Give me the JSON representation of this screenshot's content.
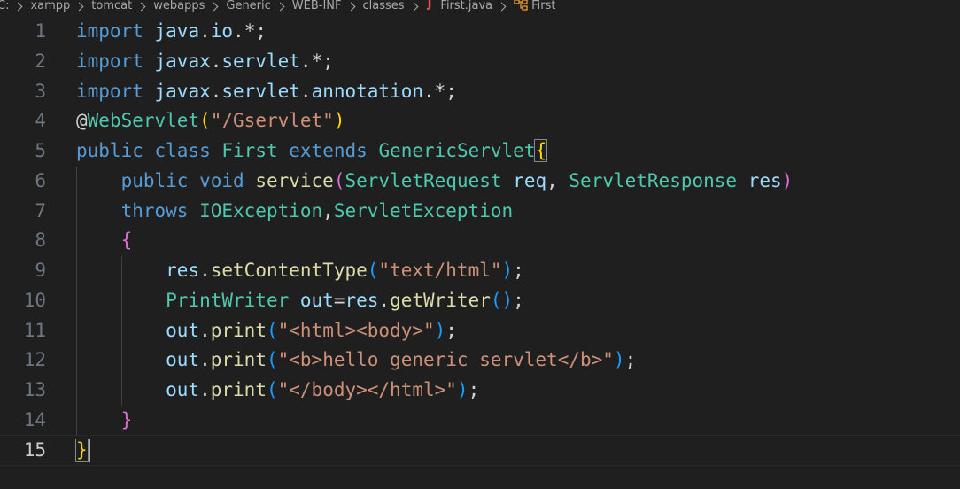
{
  "breadcrumb": {
    "items": [
      "C:",
      "xampp",
      "tomcat",
      "webapps",
      "Generic",
      "WEB-INF",
      "classes",
      "First.java",
      "First"
    ],
    "file_icon": "java-icon",
    "symbol_icon": "class-icon"
  },
  "editor": {
    "active_line": 15,
    "lines": [
      {
        "n": "1",
        "tokens": [
          [
            "kw",
            "import"
          ],
          [
            "pn",
            " "
          ],
          [
            "pk",
            "java"
          ],
          [
            "pn",
            "."
          ],
          [
            "pk",
            "io"
          ],
          [
            "pn",
            ".*;"
          ]
        ]
      },
      {
        "n": "2",
        "tokens": [
          [
            "kw",
            "import"
          ],
          [
            "pn",
            " "
          ],
          [
            "pk",
            "javax"
          ],
          [
            "pn",
            "."
          ],
          [
            "pk",
            "servlet"
          ],
          [
            "pn",
            ".*;"
          ]
        ]
      },
      {
        "n": "3",
        "tokens": [
          [
            "kw",
            "import"
          ],
          [
            "pn",
            " "
          ],
          [
            "pk",
            "javax"
          ],
          [
            "pn",
            "."
          ],
          [
            "pk",
            "servlet"
          ],
          [
            "pn",
            "."
          ],
          [
            "pk",
            "annotation"
          ],
          [
            "pn",
            ".*;"
          ]
        ]
      },
      {
        "n": "4",
        "tokens": [
          [
            "anno",
            "@"
          ],
          [
            "ty",
            "WebServlet"
          ],
          [
            "b1",
            "("
          ],
          [
            "st",
            "\"/Gservlet\""
          ],
          [
            "b1",
            ")"
          ]
        ]
      },
      {
        "n": "5",
        "tokens": [
          [
            "kw",
            "public"
          ],
          [
            "pn",
            " "
          ],
          [
            "kw",
            "class"
          ],
          [
            "pn",
            " "
          ],
          [
            "ty",
            "First"
          ],
          [
            "pn",
            " "
          ],
          [
            "kw",
            "extends"
          ],
          [
            "pn",
            " "
          ],
          [
            "ty",
            "GenericServlet"
          ],
          [
            "b1m",
            "{"
          ]
        ]
      },
      {
        "n": "6",
        "tokens": [
          [
            "pn",
            "    "
          ],
          [
            "kw",
            "public"
          ],
          [
            "pn",
            " "
          ],
          [
            "kw",
            "void"
          ],
          [
            "pn",
            " "
          ],
          [
            "fn",
            "service"
          ],
          [
            "b2",
            "("
          ],
          [
            "ty",
            "ServletRequest"
          ],
          [
            "pn",
            " "
          ],
          [
            "va",
            "req"
          ],
          [
            "pn",
            ", "
          ],
          [
            "ty",
            "ServletResponse"
          ],
          [
            "pn",
            " "
          ],
          [
            "va",
            "res"
          ],
          [
            "b2",
            ")"
          ]
        ]
      },
      {
        "n": "7",
        "tokens": [
          [
            "pn",
            "    "
          ],
          [
            "kw",
            "throws"
          ],
          [
            "pn",
            " "
          ],
          [
            "ty",
            "IOException"
          ],
          [
            "pn",
            ","
          ],
          [
            "ty",
            "ServletException"
          ]
        ]
      },
      {
        "n": "8",
        "tokens": [
          [
            "pn",
            "    "
          ],
          [
            "b2",
            "{"
          ]
        ]
      },
      {
        "n": "9",
        "tokens": [
          [
            "pn",
            "        "
          ],
          [
            "va",
            "res"
          ],
          [
            "pn",
            "."
          ],
          [
            "fn",
            "setContentType"
          ],
          [
            "b3",
            "("
          ],
          [
            "st",
            "\"text/html\""
          ],
          [
            "b3",
            ")"
          ],
          [
            "pn",
            ";"
          ]
        ]
      },
      {
        "n": "10",
        "tokens": [
          [
            "pn",
            "        "
          ],
          [
            "ty",
            "PrintWriter"
          ],
          [
            "pn",
            " "
          ],
          [
            "va",
            "out"
          ],
          [
            "pn",
            "="
          ],
          [
            "va",
            "res"
          ],
          [
            "pn",
            "."
          ],
          [
            "fn",
            "getWriter"
          ],
          [
            "b3",
            "()"
          ],
          [
            "pn",
            ";"
          ]
        ]
      },
      {
        "n": "11",
        "tokens": [
          [
            "pn",
            "        "
          ],
          [
            "va",
            "out"
          ],
          [
            "pn",
            "."
          ],
          [
            "fn",
            "print"
          ],
          [
            "b3",
            "("
          ],
          [
            "st",
            "\"<html><body>\""
          ],
          [
            "b3",
            ")"
          ],
          [
            "pn",
            ";"
          ]
        ]
      },
      {
        "n": "12",
        "tokens": [
          [
            "pn",
            "        "
          ],
          [
            "va",
            "out"
          ],
          [
            "pn",
            "."
          ],
          [
            "fn",
            "print"
          ],
          [
            "b3",
            "("
          ],
          [
            "st",
            "\"<b>hello generic servlet</b>\""
          ],
          [
            "b3",
            ")"
          ],
          [
            "pn",
            ";"
          ]
        ]
      },
      {
        "n": "13",
        "tokens": [
          [
            "pn",
            "        "
          ],
          [
            "va",
            "out"
          ],
          [
            "pn",
            "."
          ],
          [
            "fn",
            "print"
          ],
          [
            "b3",
            "("
          ],
          [
            "st",
            "\"</body></html>\""
          ],
          [
            "b3",
            ")"
          ],
          [
            "pn",
            ";"
          ]
        ]
      },
      {
        "n": "14",
        "tokens": [
          [
            "pn",
            "    "
          ],
          [
            "b2",
            "}"
          ]
        ]
      },
      {
        "n": "15",
        "tokens": [
          [
            "b1m",
            "}"
          ]
        ]
      }
    ]
  }
}
